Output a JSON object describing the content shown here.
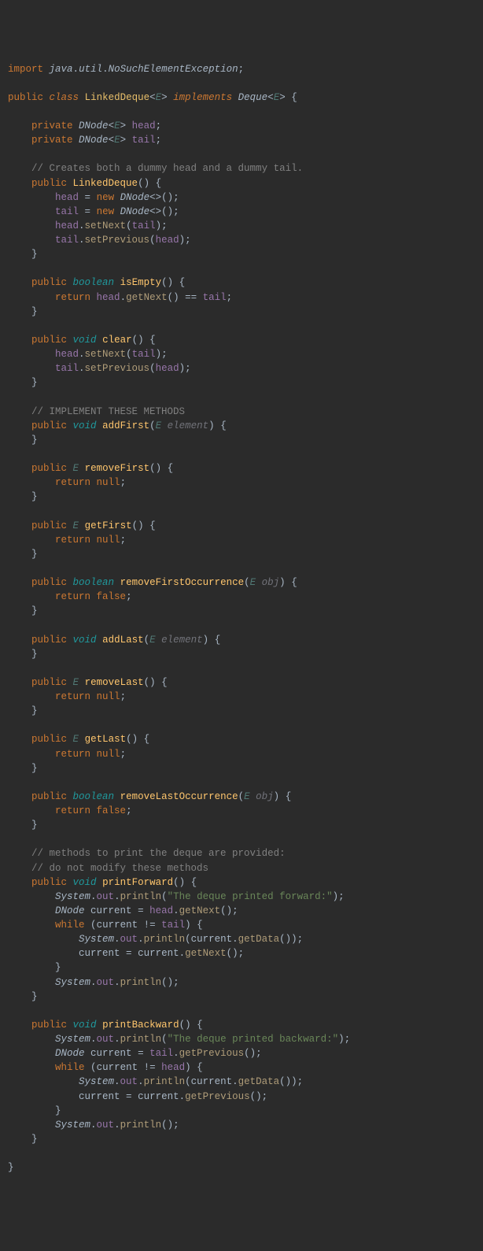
{
  "code": {
    "import_kw": "import",
    "import_pkg": "java",
    "import_util": "util",
    "import_cls": "NoSuchElementException",
    "public_kw": "public",
    "private_kw": "private",
    "class_kw": "class",
    "implements_kw": "implements",
    "return_kw": "return",
    "new_kw": "new",
    "while_kw": "while",
    "void_kw": "void",
    "boolean_kw": "boolean",
    "null_kw": "null",
    "false_kw": "false",
    "classname": "LinkedDeque",
    "interface": "Deque",
    "type_E": "E",
    "dnode": "DNode",
    "head": "head",
    "tail": "tail",
    "current": "current",
    "ctor": "LinkedDeque",
    "isEmpty": "isEmpty",
    "clear": "clear",
    "addFirst": "addFirst",
    "removeFirst": "removeFirst",
    "getFirst": "getFirst",
    "removeFirstOccurrence": "removeFirstOccurrence",
    "addLast": "addLast",
    "removeLast": "removeLast",
    "getLast": "getLast",
    "removeLastOccurrence": "removeLastOccurrence",
    "printForward": "printForward",
    "printBackward": "printBackward",
    "setNext": "setNext",
    "setPrevious": "setPrevious",
    "getNext": "getNext",
    "getPrevious": "getPrevious",
    "getData": "getData",
    "println": "println",
    "element": "element",
    "obj": "obj",
    "System": "System",
    "out": "out",
    "comment_dummy": "// Creates both a dummy head and a dummy tail.",
    "comment_impl": "// IMPLEMENT THESE METHODS",
    "comment_print1": "// methods to print the deque are provided:",
    "comment_print2": "// do not modify these methods",
    "str_fwd": "\"The deque printed forward:\"",
    "str_bwd": "\"The deque printed backward:\""
  }
}
